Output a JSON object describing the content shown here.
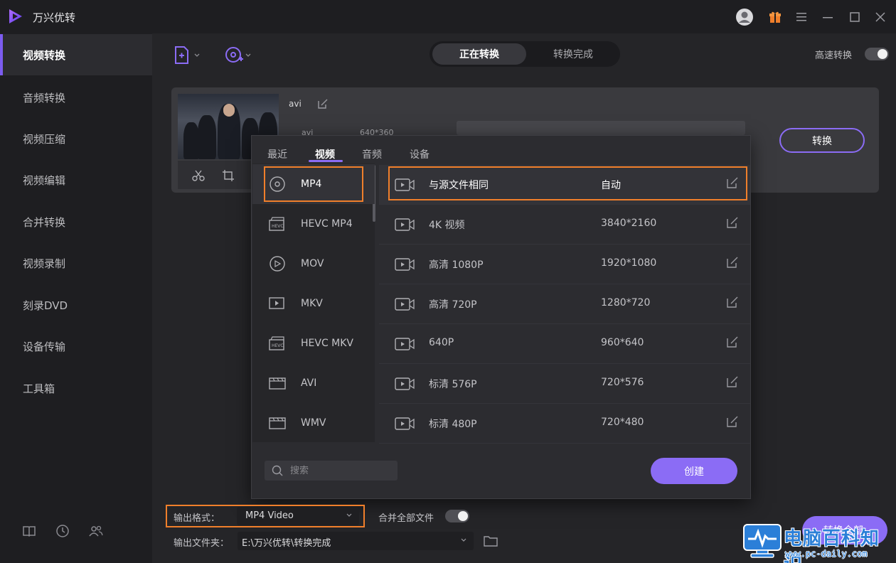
{
  "app": {
    "title": "万兴优转"
  },
  "sidebar": {
    "items": [
      {
        "label": "视频转换",
        "active": true
      },
      {
        "label": "音频转换"
      },
      {
        "label": "视频压缩"
      },
      {
        "label": "视频编辑"
      },
      {
        "label": "合并转换"
      },
      {
        "label": "视频录制"
      },
      {
        "label": "刻录DVD"
      },
      {
        "label": "设备传输"
      },
      {
        "label": "工具箱"
      }
    ],
    "bottom_icons": [
      "book-icon",
      "clock-icon",
      "users-icon"
    ]
  },
  "toolbar": {
    "add_file_icon": "add-file-icon",
    "add_disc_icon": "add-disc-icon",
    "tabs": [
      "正在转换",
      "转换完成"
    ],
    "high_speed_label": "高速转换",
    "high_speed_on": false
  },
  "file": {
    "name": "avi",
    "meta": [
      "avi",
      "640*360"
    ],
    "convert_label": "转换"
  },
  "format_popup": {
    "tabs": [
      "最近",
      "视频",
      "音频",
      "设备"
    ],
    "active_tab": "视频",
    "formats": [
      "MP4",
      "HEVC MP4",
      "MOV",
      "MKV",
      "HEVC MKV",
      "AVI",
      "WMV"
    ],
    "selected_format": "MP4",
    "resolutions": [
      {
        "name": "与源文件相同",
        "value": "自动"
      },
      {
        "name": "4K 视频",
        "value": "3840*2160"
      },
      {
        "name": "高清 1080P",
        "value": "1920*1080"
      },
      {
        "name": "高清 720P",
        "value": "1280*720"
      },
      {
        "name": "640P",
        "value": "960*640"
      },
      {
        "name": "标清 576P",
        "value": "720*576"
      },
      {
        "name": "标清 480P",
        "value": "720*480"
      }
    ],
    "search_placeholder": "搜索",
    "create_label": "创建"
  },
  "bottom": {
    "output_format_label": "输出格式：",
    "output_format_value": "MP4 Video",
    "merge_label": "合并全部文件",
    "merge_on": false,
    "output_folder_label": "输出文件夹：",
    "output_folder_value": "E:\\万兴优转\\转换完成",
    "convert_all_label": "转换全部"
  },
  "watermark": {
    "title": "电脑百科知识",
    "url": "www.pc-daily.com"
  },
  "colors": {
    "accent": "#8b6cf5",
    "highlight": "#f07f2b",
    "background": "#252528",
    "sidebar": "#1e1e21"
  }
}
